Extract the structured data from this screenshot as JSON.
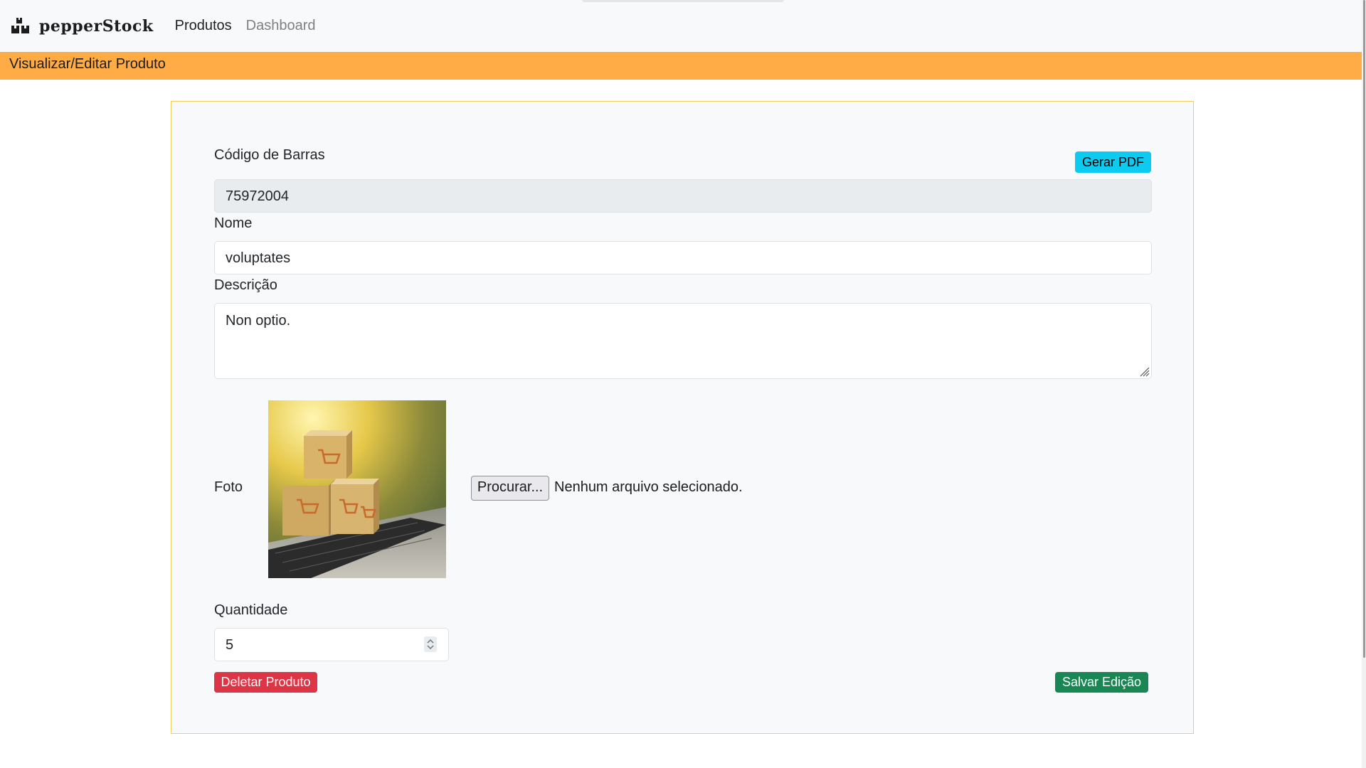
{
  "navbar": {
    "brand": "pepperStock",
    "links": [
      {
        "label": "Produtos",
        "active": true
      },
      {
        "label": "Dashboard",
        "active": false
      }
    ]
  },
  "page": {
    "title": "Visualizar/Editar Produto",
    "accent_color": "#ffac47"
  },
  "form": {
    "barcode": {
      "label": "Código de Barras",
      "value": "75972004"
    },
    "generate_pdf_label": "Gerar PDF",
    "name": {
      "label": "Nome",
      "value": "voluptates"
    },
    "description": {
      "label": "Descrição",
      "value": "Non optio."
    },
    "photo": {
      "label": "Foto",
      "browse_label": "Procurar...",
      "file_status": "Nenhum arquivo selecionado."
    },
    "quantity": {
      "label": "Quantidade",
      "value": "5"
    },
    "delete_label": "Deletar Produto",
    "save_label": "Salvar Edição"
  },
  "colors": {
    "pdf_button": "#0dcaf0",
    "delete_button": "#dc3545",
    "save_button": "#198754",
    "card_border": "#f4cf58"
  }
}
